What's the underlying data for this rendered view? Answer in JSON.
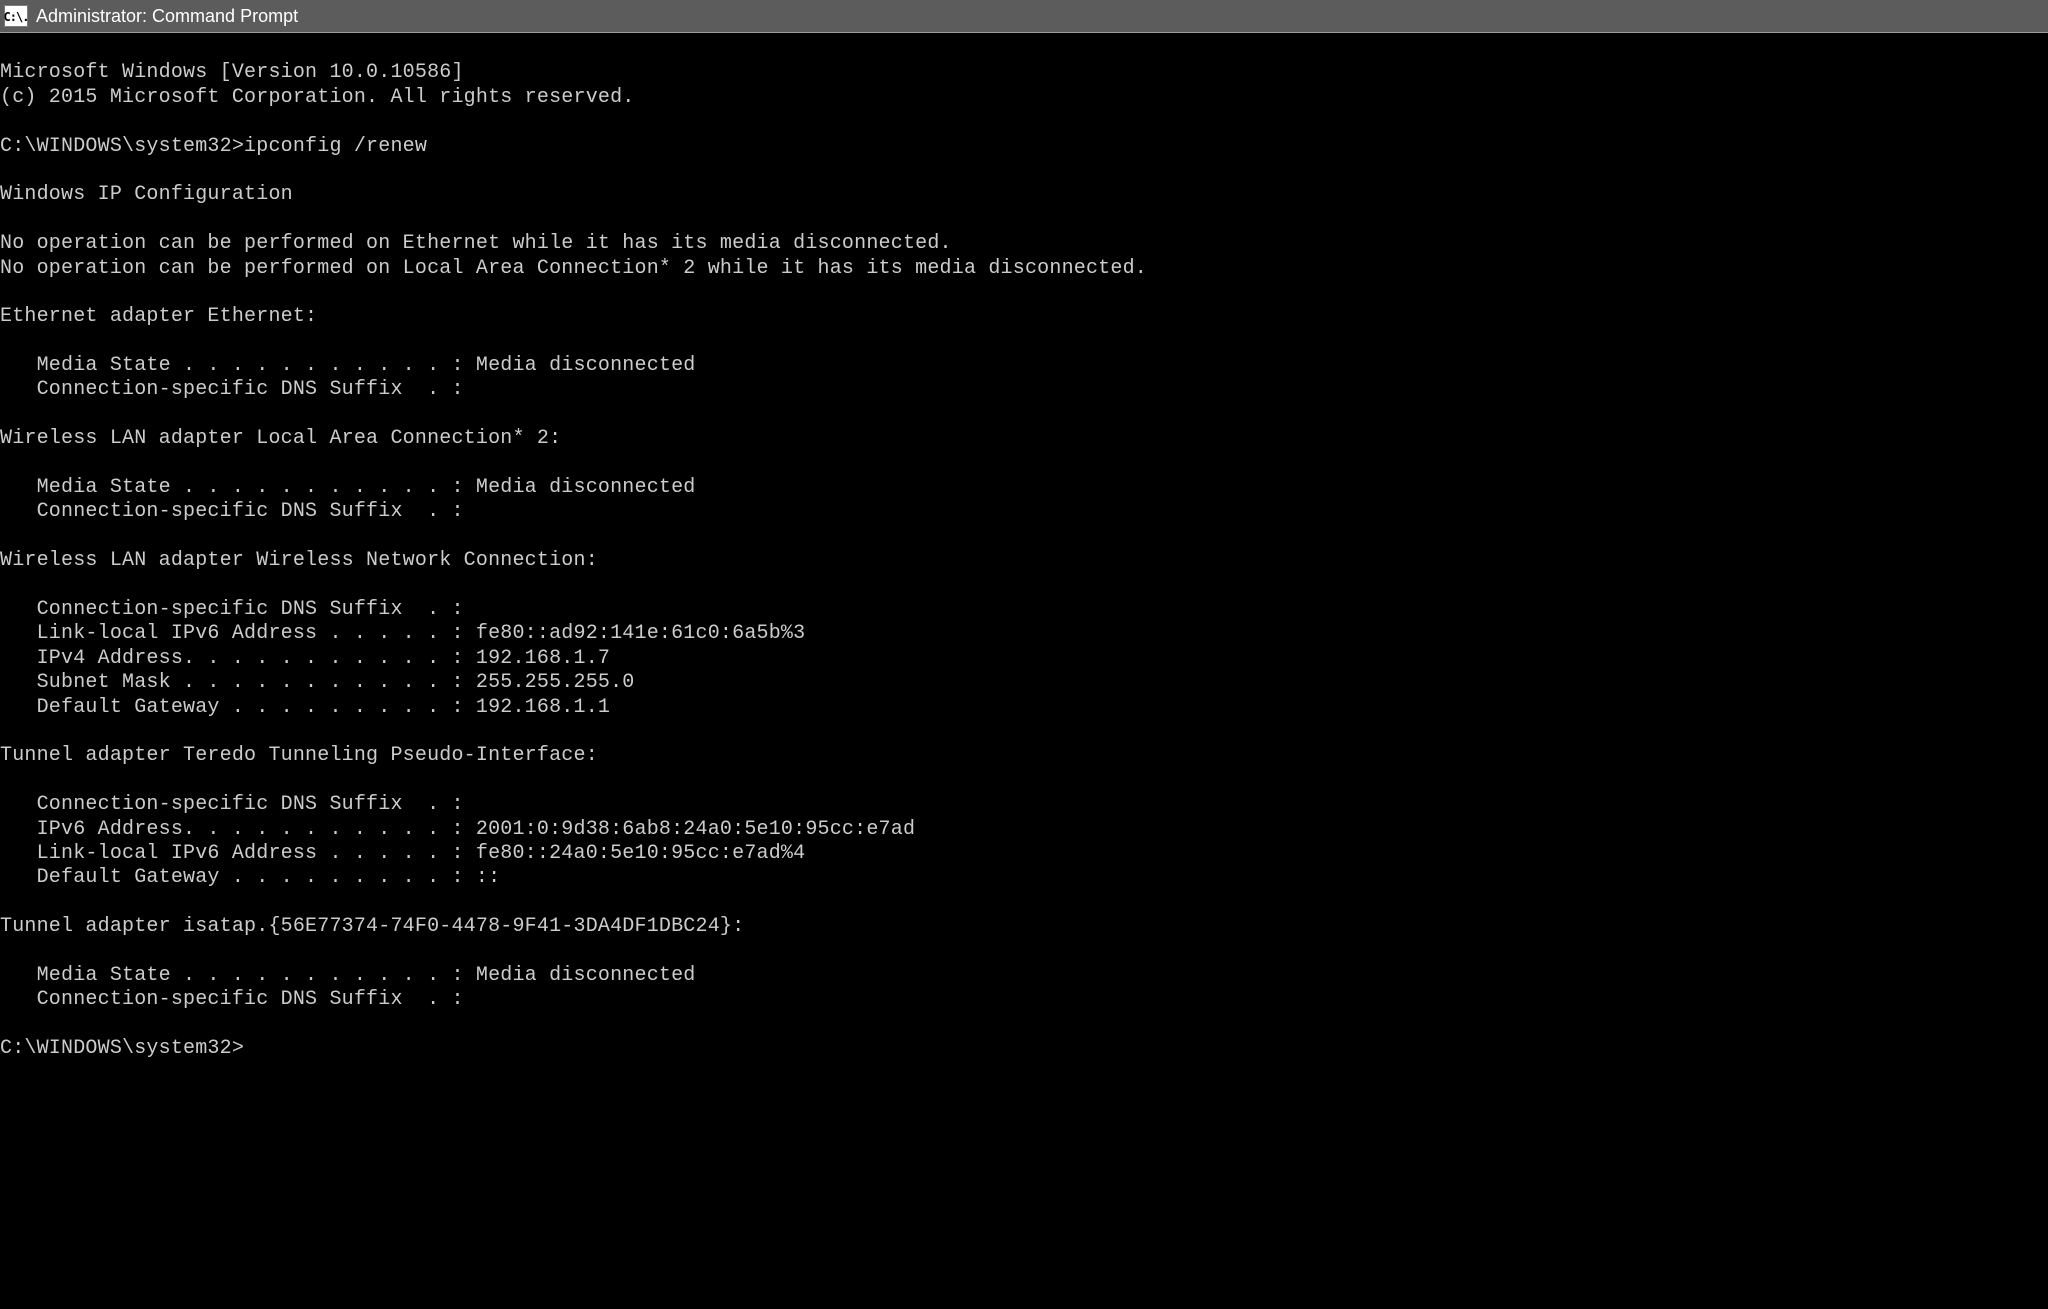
{
  "titlebar": {
    "icon_text": "C:\\.",
    "title": "Administrator: Command Prompt"
  },
  "terminal": {
    "lines": {
      "l0": "Microsoft Windows [Version 10.0.10586]",
      "l1": "(c) 2015 Microsoft Corporation. All rights reserved.",
      "l2": "",
      "l3": "C:\\WINDOWS\\system32>ipconfig /renew",
      "l4": "",
      "l5": "Windows IP Configuration",
      "l6": "",
      "l7": "No operation can be performed on Ethernet while it has its media disconnected.",
      "l8": "No operation can be performed on Local Area Connection* 2 while it has its media disconnected.",
      "l9": "",
      "l10": "Ethernet adapter Ethernet:",
      "l11": "",
      "l12": "   Media State . . . . . . . . . . . : Media disconnected",
      "l13": "   Connection-specific DNS Suffix  . :",
      "l14": "",
      "l15": "Wireless LAN adapter Local Area Connection* 2:",
      "l16": "",
      "l17": "   Media State . . . . . . . . . . . : Media disconnected",
      "l18": "   Connection-specific DNS Suffix  . :",
      "l19": "",
      "l20": "Wireless LAN adapter Wireless Network Connection:",
      "l21": "",
      "l22": "   Connection-specific DNS Suffix  . :",
      "l23": "   Link-local IPv6 Address . . . . . : fe80::ad92:141e:61c0:6a5b%3",
      "l24": "   IPv4 Address. . . . . . . . . . . : 192.168.1.7",
      "l25": "   Subnet Mask . . . . . . . . . . . : 255.255.255.0",
      "l26": "   Default Gateway . . . . . . . . . : 192.168.1.1",
      "l27": "",
      "l28": "Tunnel adapter Teredo Tunneling Pseudo-Interface:",
      "l29": "",
      "l30": "   Connection-specific DNS Suffix  . :",
      "l31": "   IPv6 Address. . . . . . . . . . . : 2001:0:9d38:6ab8:24a0:5e10:95cc:e7ad",
      "l32": "   Link-local IPv6 Address . . . . . : fe80::24a0:5e10:95cc:e7ad%4",
      "l33": "   Default Gateway . . . . . . . . . : ::",
      "l34": "",
      "l35": "Tunnel adapter isatap.{56E77374-74F0-4478-9F41-3DA4DF1DBC24}:",
      "l36": "",
      "l37": "   Media State . . . . . . . . . . . : Media disconnected",
      "l38": "   Connection-specific DNS Suffix  . :",
      "l39": "",
      "l40": "C:\\WINDOWS\\system32>"
    }
  }
}
